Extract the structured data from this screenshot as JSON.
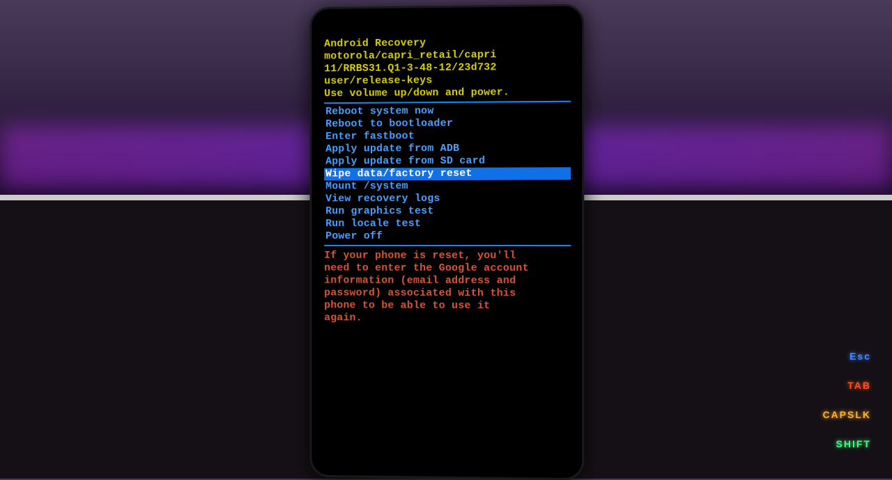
{
  "header": {
    "title": "Android Recovery",
    "device": "motorola/capri_retail/capri",
    "build": "11/RRBS31.Q1-3-48-12/23d732",
    "keys": "user/release-keys",
    "instruction": "Use volume up/down and power."
  },
  "menu": {
    "items": [
      {
        "label": "Reboot system now",
        "selected": false
      },
      {
        "label": "Reboot to bootloader",
        "selected": false
      },
      {
        "label": "Enter fastboot",
        "selected": false
      },
      {
        "label": "Apply update from ADB",
        "selected": false
      },
      {
        "label": "Apply update from SD card",
        "selected": false
      },
      {
        "label": "Wipe data/factory reset",
        "selected": true
      },
      {
        "label": "Mount /system",
        "selected": false
      },
      {
        "label": "View recovery logs",
        "selected": false
      },
      {
        "label": "Run graphics test",
        "selected": false
      },
      {
        "label": "Run locale test",
        "selected": false
      },
      {
        "label": "Power off",
        "selected": false
      }
    ]
  },
  "warning": "If your phone is reset, you'll\nneed to enter the Google account\ninformation (email address and\npassword) associated with this\nphone to be able to use it\nagain.",
  "keyboard": {
    "esc": "Esc",
    "tab": "TAB",
    "caps": "CAPSLK",
    "shift": "SHIFT"
  }
}
